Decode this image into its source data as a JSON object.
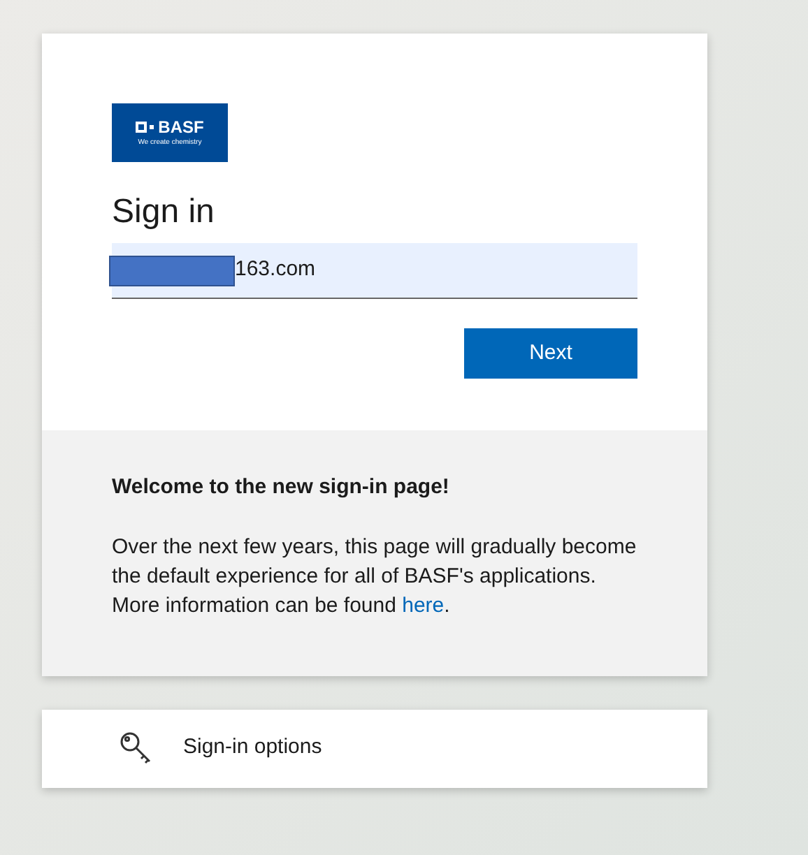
{
  "logo": {
    "name": "BASF",
    "tagline": "We create chemistry"
  },
  "title": "Sign in",
  "email_field": {
    "value": "163.com",
    "redacted": true
  },
  "next_button": "Next",
  "notice": {
    "heading": "Welcome to the new sign-in page!",
    "body": "Over the next few years, this page will gradually become the default experience for all of BASF's applications. More information can be found ",
    "link": "here",
    "end": "."
  },
  "options_button": "Sign-in options"
}
